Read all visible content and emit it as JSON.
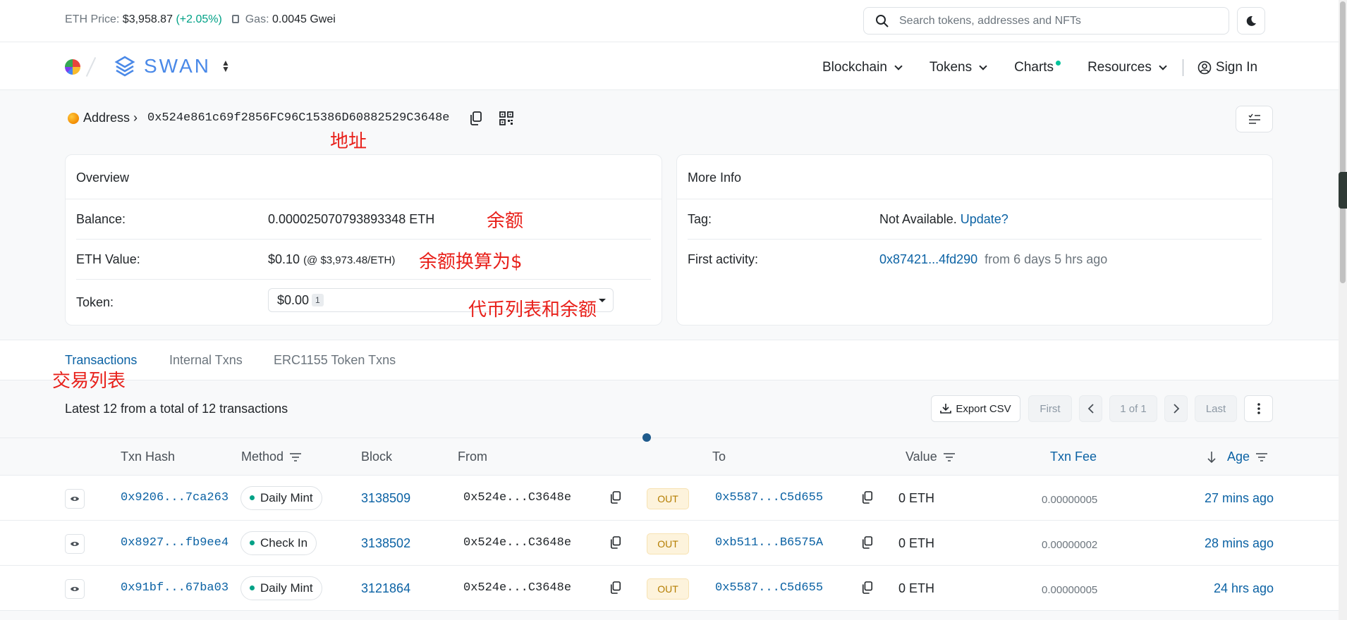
{
  "topbar": {
    "eth_price_label": "ETH Price:",
    "eth_price": "$3,958.87",
    "eth_change": "(+2.05%)",
    "gas_label": "Gas:",
    "gas_value": "0.0045 Gwei",
    "search_placeholder": "Search tokens, addresses and NFTs"
  },
  "brand": {
    "name": "SWAN"
  },
  "nav": {
    "items": [
      {
        "label": "Blockchain"
      },
      {
        "label": "Tokens"
      },
      {
        "label": "Charts"
      },
      {
        "label": "Resources"
      }
    ],
    "sign_in": "Sign In"
  },
  "address": {
    "label": "Address ›",
    "hash": "0x524e861c69f2856FC96C15386D60882529C3648e"
  },
  "annotations": {
    "address": "地址",
    "balance": "余额",
    "eth_value": "余额换算为$",
    "token": "代币列表和余额",
    "tx_list": "交易列表"
  },
  "overview": {
    "title": "Overview",
    "balance_label": "Balance:",
    "balance_value": "0.000025070793893348 ETH",
    "eth_value_label": "ETH Value:",
    "eth_value": "$0.10",
    "eth_rate": "(@ $3,973.48/ETH)",
    "token_label": "Token:",
    "token_value": "$0.00",
    "token_count": "1"
  },
  "more_info": {
    "title": "More Info",
    "tag_label": "Tag:",
    "tag_value": "Not Available.",
    "tag_link": "Update?",
    "first_activity_label": "First activity:",
    "first_activity_hash": "0x87421...4fd290",
    "first_activity_time": "from 6 days 5 hrs ago"
  },
  "tabs": [
    {
      "label": "Transactions",
      "active": true
    },
    {
      "label": "Internal Txns",
      "active": false
    },
    {
      "label": "ERC1155 Token Txns",
      "active": false
    }
  ],
  "table": {
    "summary": "Latest 12 from a total of 12 transactions",
    "export_label": "Export CSV",
    "pager": {
      "first": "First",
      "page": "1 of 1",
      "last": "Last"
    },
    "columns": {
      "hash": "Txn Hash",
      "method": "Method",
      "block": "Block",
      "from": "From",
      "to": "To",
      "value": "Value",
      "fee": "Txn Fee",
      "age": "Age"
    },
    "rows": [
      {
        "hash": "0x9206...7ca263",
        "method": "Daily Mint",
        "block": "3138509",
        "from": "0x524e...C3648e",
        "direction": "OUT",
        "to": "0x5587...C5d655",
        "value": "0 ETH",
        "fee": "0.00000005",
        "age": "27 mins ago"
      },
      {
        "hash": "0x8927...fb9ee4",
        "method": "Check In",
        "block": "3138502",
        "from": "0x524e...C3648e",
        "direction": "OUT",
        "to": "0xb511...B6575A",
        "value": "0 ETH",
        "fee": "0.00000002",
        "age": "28 mins ago"
      },
      {
        "hash": "0x91bf...67ba03",
        "method": "Daily Mint",
        "block": "3121864",
        "from": "0x524e...C3648e",
        "direction": "OUT",
        "to": "0x5587...C5d655",
        "value": "0 ETH",
        "fee": "0.00000005",
        "age": "24 hrs ago"
      }
    ]
  },
  "colors": {
    "accent": "#0b62a4",
    "success": "#00a186",
    "annotation": "#e8201a",
    "out_badge": "#b47d00"
  }
}
